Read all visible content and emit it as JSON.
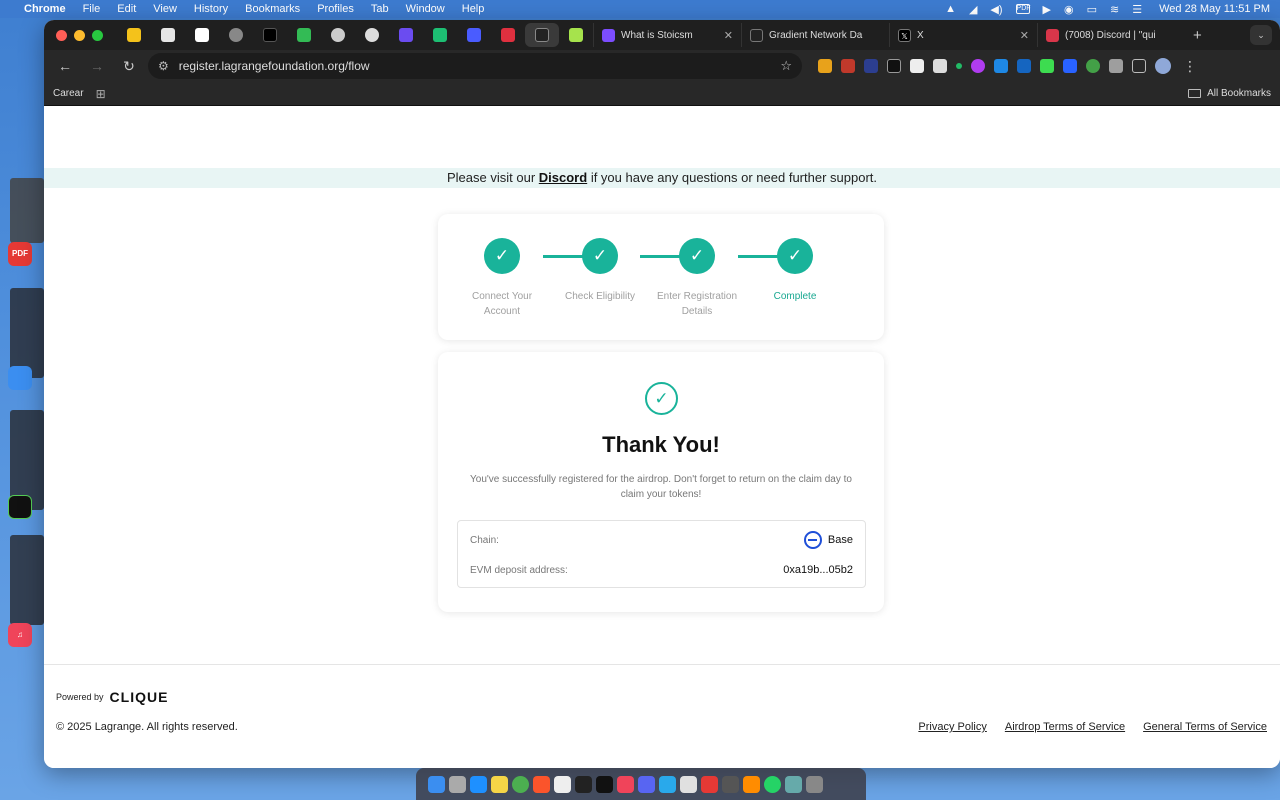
{
  "menubar": {
    "app": "Chrome",
    "items": [
      "File",
      "Edit",
      "View",
      "History",
      "Bookmarks",
      "Profiles",
      "Tab",
      "Window",
      "Help"
    ],
    "pdf_badge": "PDF",
    "clock": "Wed 28 May  11:51 PM"
  },
  "side": {
    "pdf_label": "PDF"
  },
  "tabs": [
    {
      "title": "What is Stoicsm",
      "favicon_color": "#7c4dff"
    },
    {
      "title": "Gradient Network Da",
      "favicon_color": "#222222"
    },
    {
      "title": "X",
      "favicon_color": "#000000"
    },
    {
      "title": "(7008) Discord | \"qui",
      "favicon_color": "#d9364a"
    }
  ],
  "toolbar": {
    "url": "register.lagrangefoundation.org/flow"
  },
  "bookmarks": {
    "item": "Carear",
    "all": "All Bookmarks"
  },
  "banner": {
    "prefix": "Please visit our",
    "link": "Discord",
    "suffix": "if you have any questions or need further support."
  },
  "steps": [
    {
      "label": "Connect Your Account",
      "status": "done"
    },
    {
      "label": "Check Eligibility",
      "status": "done"
    },
    {
      "label": "Enter Registration Details",
      "status": "done"
    },
    {
      "label": "Complete",
      "status": "current"
    }
  ],
  "result": {
    "title": "Thank You!",
    "message": "You've successfully registered for the airdrop. Don't forget to return on the claim day to claim your tokens!",
    "chain_label": "Chain:",
    "chain_value": "Base",
    "address_label": "EVM deposit address:",
    "address_value": "0xa19b...05b2"
  },
  "footer": {
    "powered_by": "Powered by",
    "brand": "CLIQUE",
    "copyright": "© 2025 Lagrange. All rights reserved.",
    "links": [
      "Privacy Policy",
      "Airdrop Terms of Service",
      "General Terms of Service"
    ]
  },
  "colors": {
    "accent": "#19b39a",
    "base_blue": "#1f4fd8"
  }
}
